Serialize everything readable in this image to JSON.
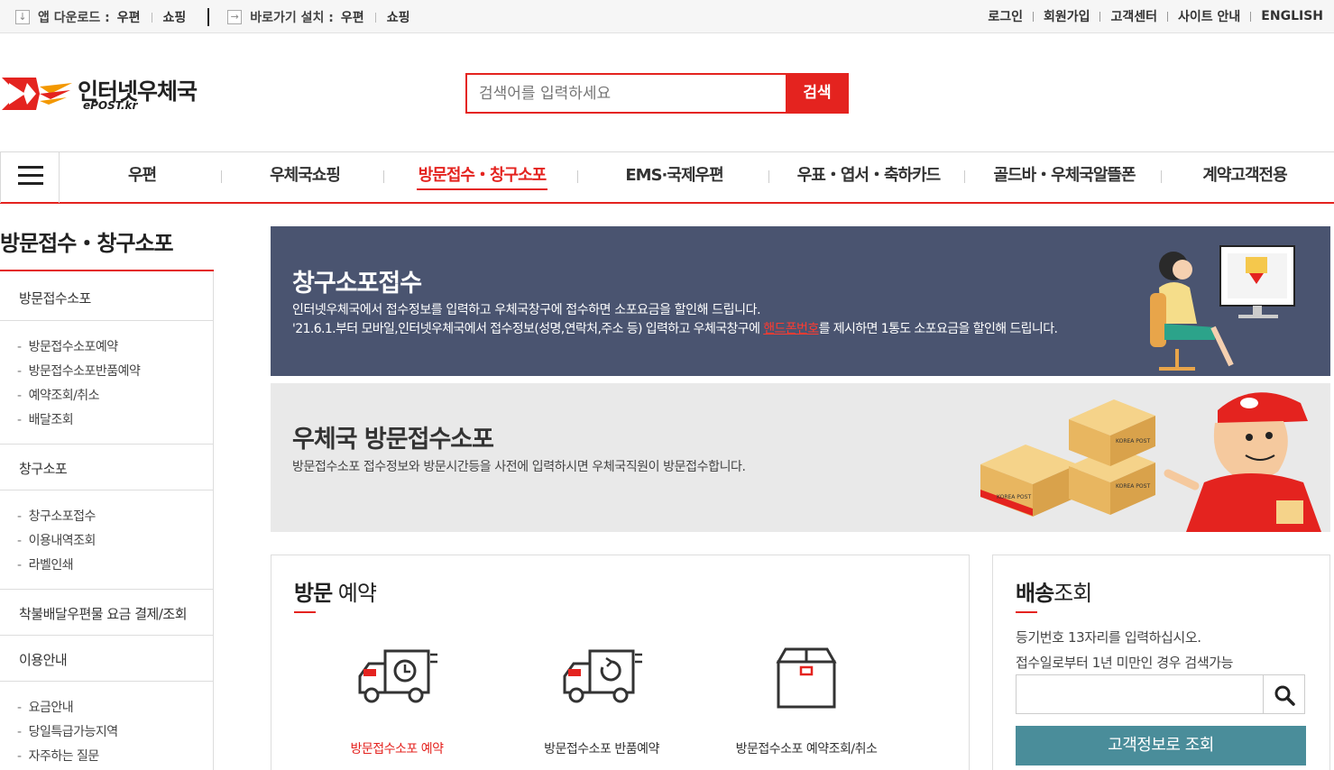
{
  "topbar": {
    "app_download_label": "앱 다운로드 :",
    "app_links": [
      "우편",
      "쇼핑"
    ],
    "shortcut_label": "바로가기 설치 :",
    "shortcut_links": [
      "우편",
      "쇼핑"
    ],
    "right_links": [
      "로그인",
      "회원가입",
      "고객센터",
      "사이트 안내",
      "ENGLISH"
    ]
  },
  "header": {
    "logo_text": "인터넷우체국",
    "logo_sub": "ePOST.kr",
    "search_placeholder": "검색어를 입력하세요",
    "search_button": "검색"
  },
  "gnb": {
    "items": [
      "우편",
      "우체국쇼핑",
      "방문접수・창구소포",
      "EMS·국제우편",
      "우표・엽서・축하카드",
      "골드바・우체국알뜰폰",
      "계약고객전용"
    ],
    "active_index": 2
  },
  "sidebar": {
    "title": "방문접수・창구소포",
    "sections": [
      {
        "head": "방문접수소포",
        "items": [
          "방문접수소포예약",
          "방문접수소포반품예약",
          "예약조회/취소",
          "배달조회"
        ]
      },
      {
        "head": "창구소포",
        "items": [
          "창구소포접수",
          "이용내역조회",
          "라벨인쇄"
        ]
      },
      {
        "head": "착불배달우편물 요금 결제/조회",
        "items": []
      },
      {
        "head": "이용안내",
        "items": [
          "요금안내",
          "당일특급가능지역",
          "자주하는 질문"
        ]
      }
    ]
  },
  "banner_counter": {
    "title": "창구소포접수",
    "line1": "인터넷우체국에서 접수정보를 입력하고 우체국창구에 접수하면 소포요금을 할인해 드립니다.",
    "line2_prefix": "'21.6.1.부터 모바일,인터넷우체국에서 접수정보(성명,연락처,주소 등) 입력하고 우체국창구에 ",
    "line2_highlight": "핸드폰번호",
    "line2_suffix": "를 제시하면 1통도 소포요금을 할인해 드립니다."
  },
  "banner_visit": {
    "title": "우체국 방문접수소포",
    "desc": "방문접수소포 접수정보와 방문시간등을 사전에 입력하시면 우체국직원이 방문접수합니다.",
    "box_label": "KOREA POST"
  },
  "visit_card": {
    "title_bold": "방문",
    "title_rest": " 예약",
    "services": [
      {
        "label": "방문접수소포 예약",
        "icon": "truck-clock-icon"
      },
      {
        "label": "방문접수소포 반품예약",
        "icon": "truck-return-icon"
      },
      {
        "label": "방문접수소포 예약조회/취소",
        "icon": "box-icon"
      }
    ]
  },
  "track_card": {
    "title_bold": "배송",
    "title_rest": "조회",
    "desc1": "등기번호 13자리를 입력하십시오.",
    "desc2": "접수일로부터 1년 미만인 경우 검색가능",
    "input_value": "",
    "submit_label": "고객정보로 조회"
  },
  "colors": {
    "accent": "#e4231f",
    "banner_dark": "#4a5470",
    "banner_light": "#e9e9e9",
    "teal": "#4a8d9a"
  }
}
